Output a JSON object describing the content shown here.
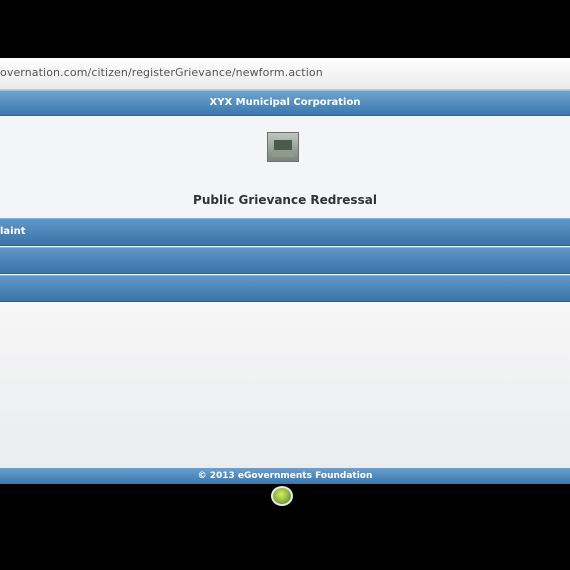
{
  "browser": {
    "url": "overnation.com/citizen/registerGrievance/newform.action"
  },
  "header": {
    "title": "XYX Municipal Corporation"
  },
  "page": {
    "title": "Public Grievance Redressal",
    "logo_icon": "municipal-logo-icon"
  },
  "sections": [
    {
      "label": "laint"
    },
    {
      "label": ""
    },
    {
      "label": ""
    }
  ],
  "footer": {
    "text": "© 2013 eGovernments Foundation"
  },
  "colors": {
    "accent": "#3b78ad",
    "background": "#f5f6f7",
    "frame": "#000000"
  }
}
